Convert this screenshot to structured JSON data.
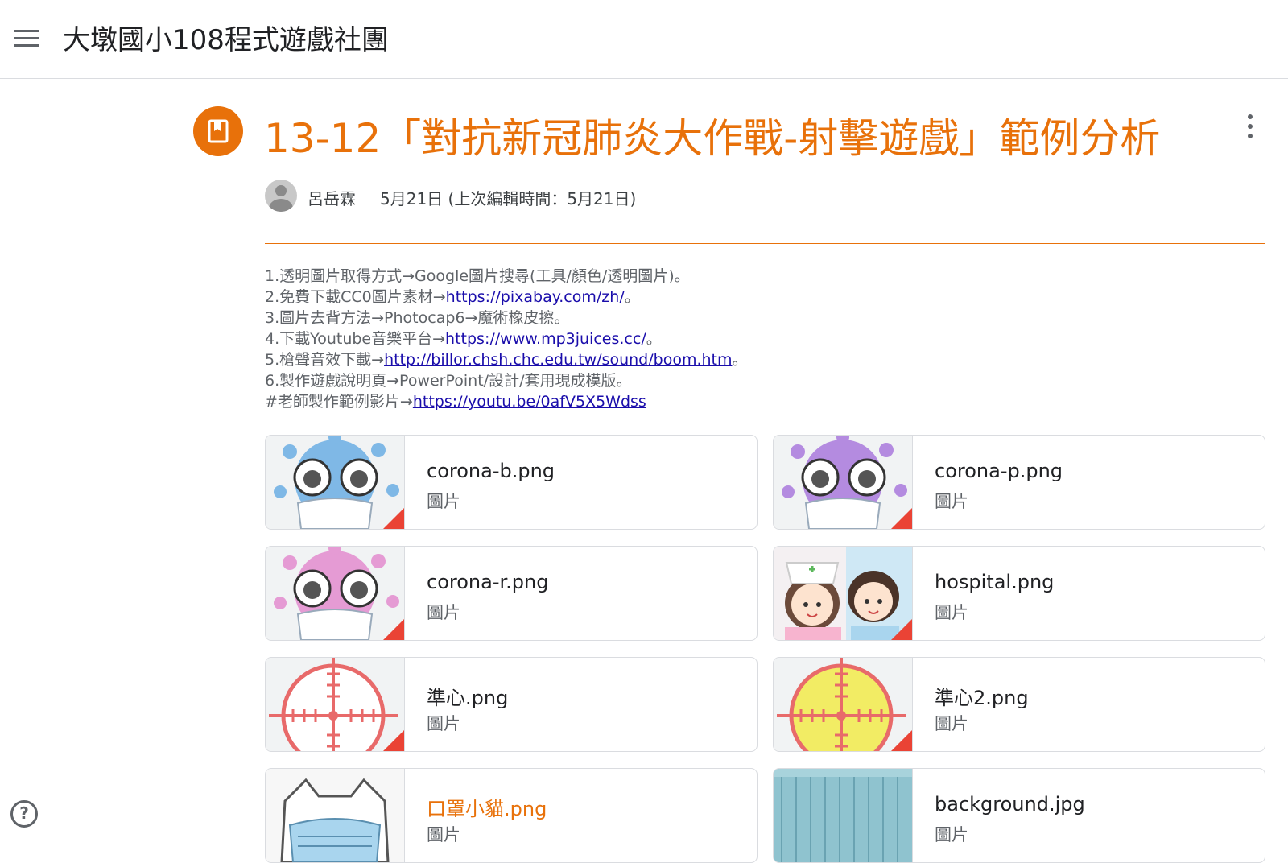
{
  "header": {
    "menu_icon": "hamburger-menu-icon",
    "class_title": "大墩國小108程式遊戲社團"
  },
  "post": {
    "icon": "material-bookmark-icon",
    "accent_color": "#e8710a",
    "title": "13-12「對抗新冠肺炎大作戰-射擊遊戲」範例分析",
    "author": "呂岳霖",
    "date": "5月21日 (上次編輯時間：5月21日)",
    "description": [
      {
        "text": "1.透明圖片取得方式→Google圖片搜尋(工具/顏色/透明圖片)。",
        "link": "",
        "suffix": ""
      },
      {
        "text": "2.免費下載CC0圖片素材→",
        "link": "https://pixabay.com/zh/",
        "suffix": "。"
      },
      {
        "text": "3.圖片去背方法→Photocap6→魔術橡皮擦。",
        "link": "",
        "suffix": ""
      },
      {
        "text": "4.下載Youtube音樂平台→",
        "link": "https://www.mp3juices.cc/",
        "suffix": "。"
      },
      {
        "text": "5.槍聲音效下載→",
        "link": "http://billor.chsh.chc.edu.tw/sound/boom.htm",
        "suffix": "。"
      },
      {
        "text": "6.製作遊戲說明頁→PowerPoint/設計/套用現成模版。",
        "link": "",
        "suffix": ""
      },
      {
        "text": "#老師製作範例影片→",
        "link": "https://youtu.be/0afV5X5Wdss",
        "suffix": ""
      }
    ]
  },
  "attachments": [
    {
      "name": "corona-b.png",
      "type": "圖片",
      "thumb": "virus-blue"
    },
    {
      "name": "corona-p.png",
      "type": "圖片",
      "thumb": "virus-purple"
    },
    {
      "name": "corona-r.png",
      "type": "圖片",
      "thumb": "virus-pink"
    },
    {
      "name": "hospital.png",
      "type": "圖片",
      "thumb": "nurse-doctor"
    },
    {
      "name": "準心.png",
      "type": "圖片",
      "thumb": "crosshair-white"
    },
    {
      "name": "準心2.png",
      "type": "圖片",
      "thumb": "crosshair-yellow"
    },
    {
      "name": "口罩小貓.png",
      "type": "圖片",
      "thumb": "masked-cat"
    },
    {
      "name": "background.jpg",
      "type": "圖片",
      "thumb": "wood-background"
    }
  ],
  "footer": {
    "help_label": "?"
  }
}
